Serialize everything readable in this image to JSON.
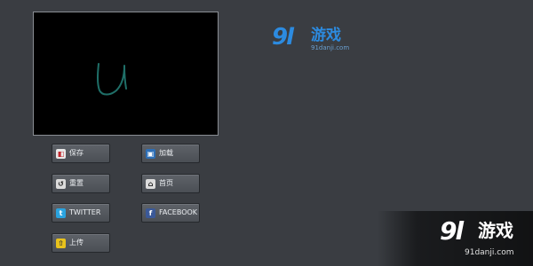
{
  "canvas": {
    "sketch_color": "#1f6f68"
  },
  "buttons": {
    "save": {
      "label": "保存",
      "icon": "save-icon"
    },
    "load": {
      "label": "加载",
      "icon": "load-icon"
    },
    "reset": {
      "label": "重置",
      "icon": "reset-icon"
    },
    "home": {
      "label": "首页",
      "icon": "home-icon"
    },
    "twitter": {
      "label": "TWITTER",
      "icon": "twitter-icon"
    },
    "facebook": {
      "label": "FACEBOOK",
      "icon": "facebook-icon"
    },
    "upload": {
      "label": "上传",
      "icon": "upload-icon"
    }
  },
  "logo": {
    "mark": "9l",
    "name": "游戏",
    "url": "91danji.com"
  },
  "watermark": {
    "mark": "9l",
    "name": "游戏",
    "url": "91danji.com"
  },
  "colors": {
    "background": "#3a3d42",
    "brand_blue": "#2c8be0"
  }
}
